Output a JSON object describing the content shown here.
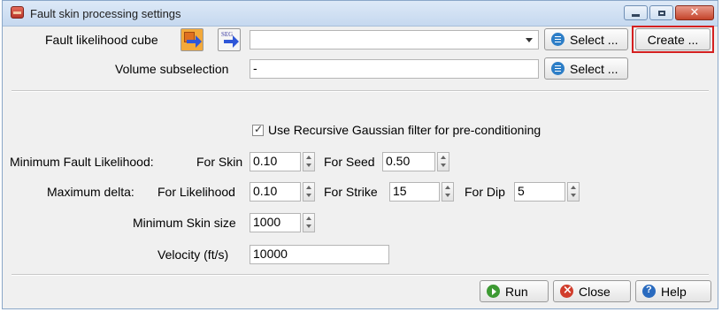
{
  "window": {
    "title": "Fault skin processing settings"
  },
  "input": {
    "label": "Fault likelihood cube",
    "select_label": "Select ...",
    "create_label": "Create ...",
    "value": ""
  },
  "subselection": {
    "label": "Volume subselection",
    "value": "-",
    "select_label": "Select ..."
  },
  "gaussian": {
    "label": "Use Recursive Gaussian filter for pre-conditioning",
    "checked": true
  },
  "min_likelihood": {
    "label": "Minimum Fault Likelihood:",
    "skin_label": "For Skin",
    "skin_value": "0.10",
    "seed_label": "For Seed",
    "seed_value": "0.50"
  },
  "max_delta": {
    "label": "Maximum delta:",
    "likelihood_label": "For Likelihood",
    "likelihood_value": "0.10",
    "strike_label": "For Strike",
    "strike_value": "15",
    "dip_label": "For Dip",
    "dip_value": "5"
  },
  "skin_size": {
    "label": "Minimum Skin size",
    "value": "1000"
  },
  "velocity": {
    "label": "Velocity (ft/s)",
    "value": "10000"
  },
  "footer": {
    "run_label": "Run",
    "close_label": "Close",
    "help_label": "Help"
  },
  "colors": {
    "highlight": "#d42020",
    "run_icon": "#3d9a33",
    "close_icon": "#d13d2c",
    "help_icon": "#2a6bbf"
  }
}
